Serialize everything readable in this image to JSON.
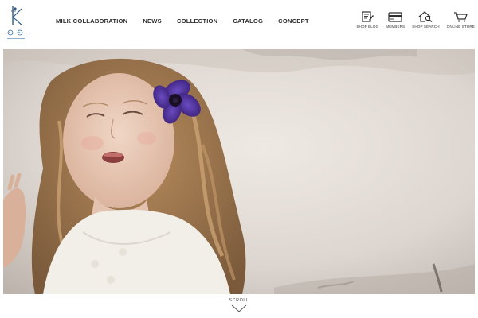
{
  "header": {
    "nav": [
      {
        "label": "MILK COLLABORATION"
      },
      {
        "label": "NEWS"
      },
      {
        "label": "COLLECTION"
      },
      {
        "label": "CATALOG"
      },
      {
        "label": "CONCEPT"
      }
    ],
    "utilities": [
      {
        "label": "SHOP BLOG",
        "icon": "blog-icon"
      },
      {
        "label": "MEMBERS",
        "icon": "member-card-icon"
      },
      {
        "label": "SHOP SEARCH",
        "icon": "shop-search-icon"
      },
      {
        "label": "ONLINE STORE",
        "icon": "cart-icon"
      }
    ]
  },
  "hero": {
    "flower_color": "#4b2a8f",
    "background_color": "#ddd6d0"
  },
  "scroll": {
    "label": "SCROLL"
  }
}
